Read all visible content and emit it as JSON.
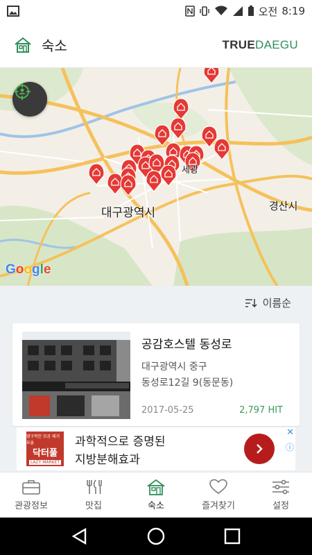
{
  "status_bar": {
    "carrier_text": "오전",
    "time": "8:19"
  },
  "app_bar": {
    "title": "숙소",
    "brand_part1": "TRUE",
    "brand_part2": "DAEGU"
  },
  "map": {
    "labels": {
      "city": "대구광역시",
      "gyeongsan": "경산시",
      "partial": "세광"
    },
    "google_letters": [
      "G",
      "o",
      "o",
      "g",
      "l",
      "e"
    ],
    "google_colors": [
      "#4285F4",
      "#EA4335",
      "#FBBC05",
      "#4285F4",
      "#34A853",
      "#EA4335"
    ],
    "marker_color": "#e53935"
  },
  "sort": {
    "label": "이름순"
  },
  "listing": {
    "title": "공감호스텔 동성로",
    "address_line1": "대구광역시 중구",
    "address_line2": "동성로12길 9(동문동)",
    "date": "2017-05-25",
    "hits": "2,797 HIT"
  },
  "ad": {
    "logo_top": "영구적인 모공 제거 요술",
    "logo_name": "닥터풀",
    "logo_sub": "LAZY MARKET",
    "line1": "과학적으로 증명된",
    "line2": "지방분해효과"
  },
  "bottom_nav": [
    {
      "label": "관광정보",
      "icon": "suitcase-icon"
    },
    {
      "label": "맛집",
      "icon": "fork-knife-icon"
    },
    {
      "label": "숙소",
      "icon": "house-icon"
    },
    {
      "label": "즐겨찾기",
      "icon": "heart-icon"
    },
    {
      "label": "설정",
      "icon": "sliders-icon"
    }
  ],
  "colors": {
    "accent": "#2e8f5a",
    "marker": "#e53935",
    "hit": "#3a9a5b",
    "ad_button": "#b71c1c"
  }
}
